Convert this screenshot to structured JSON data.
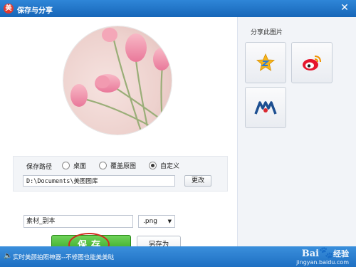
{
  "window": {
    "title": "保存与分享",
    "app_icon": "美"
  },
  "preview": {
    "image_icon": "tulip-photo-icon"
  },
  "save_path": {
    "label": "保存路径",
    "options": [
      {
        "label": "桌面",
        "selected": false
      },
      {
        "label": "覆盖原图",
        "selected": false
      },
      {
        "label": "自定义",
        "selected": true
      }
    ],
    "path_value": "D:\\Documents\\美图图库",
    "change_label": "更改"
  },
  "file": {
    "name_value": "素材_副本",
    "format_value": ".png"
  },
  "actions": {
    "save_label": "保存",
    "save_as_label": "另存为"
  },
  "share": {
    "title": "分享此图片",
    "targets": [
      {
        "icon": "qzone-star-icon"
      },
      {
        "icon": "weibo-icon"
      },
      {
        "icon": "renren-icon"
      }
    ]
  },
  "status": {
    "text": "实时美颜拍照神器--不修图也能美美哒"
  },
  "watermark": {
    "brand": "Bai",
    "brand_suffix": "经验",
    "url": "jingyan.baidu.com"
  },
  "colors": {
    "titlebar": "#1e73c6",
    "save_button": "#3bb02a",
    "highlight_ring": "#d02a20"
  }
}
